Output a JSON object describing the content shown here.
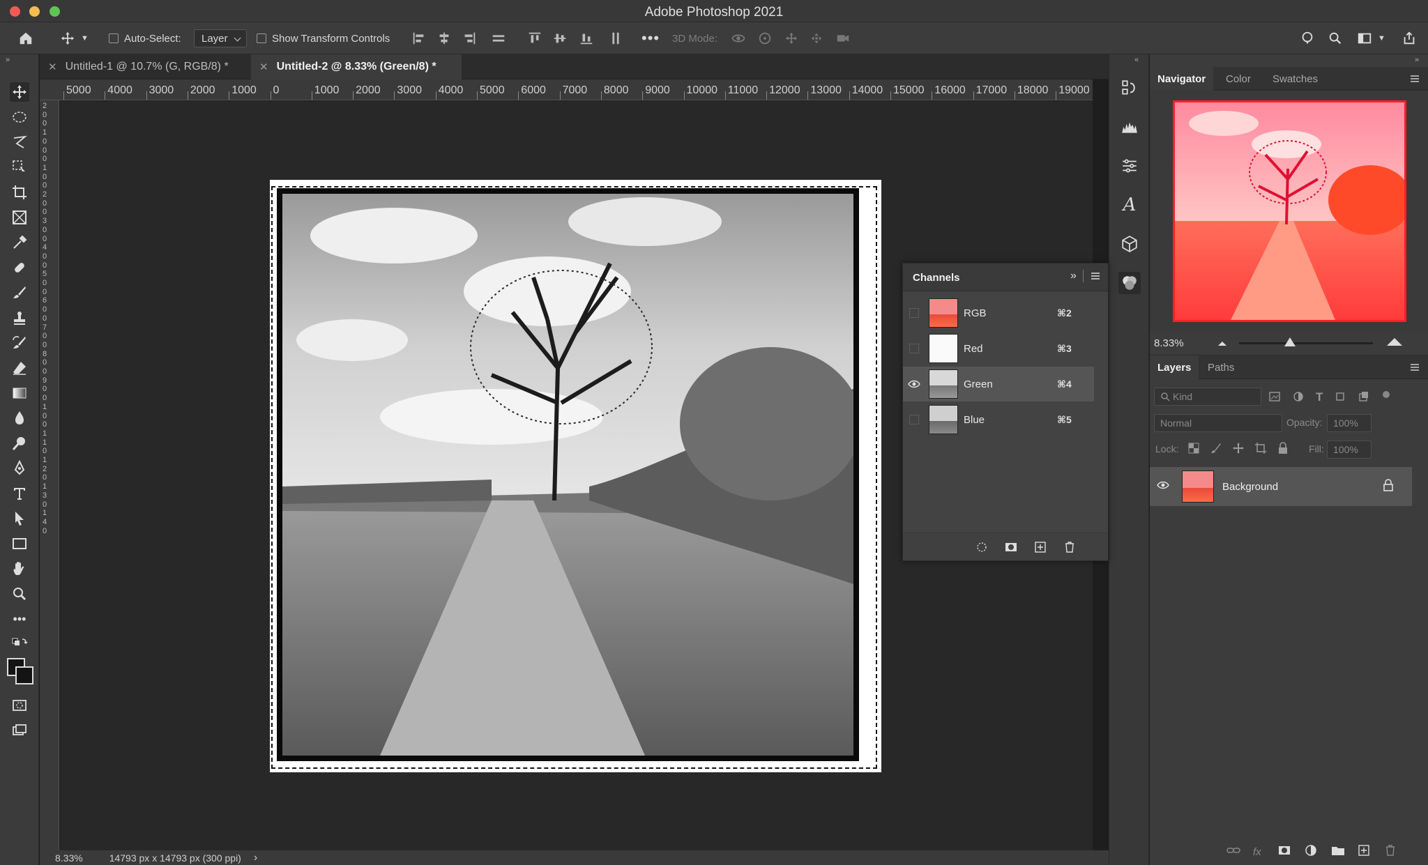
{
  "window": {
    "title": "Adobe Photoshop 2021"
  },
  "options_bar": {
    "auto_select_label": "Auto-Select:",
    "auto_select_value": "Layer",
    "show_transform_label": "Show Transform Controls",
    "mode_3d_label": "3D Mode:"
  },
  "tabs": [
    {
      "label": "Untitled-1 @ 10.7% (G, RGB/8) *",
      "active": false
    },
    {
      "label": "Untitled-2 @ 8.33% (Green/8) *",
      "active": true
    }
  ],
  "ruler": {
    "h_labels": [
      "5000",
      "4000",
      "3000",
      "2000",
      "1000",
      "0",
      "1000",
      "2000",
      "3000",
      "4000",
      "5000",
      "6000",
      "7000",
      "8000",
      "9000",
      "10000",
      "11000",
      "12000",
      "13000",
      "14000",
      "15000",
      "16000",
      "17000",
      "18000",
      "19000"
    ],
    "v_labels": [
      "2",
      "0",
      "0",
      "1",
      "0",
      "0",
      "0",
      "1",
      "0",
      "0",
      "2",
      "0",
      "0",
      "3",
      "0",
      "0",
      "4",
      "0",
      "0",
      "5",
      "0",
      "0",
      "6",
      "0",
      "0",
      "7",
      "0",
      "0",
      "8",
      "0",
      "0",
      "9",
      "0",
      "0",
      "1",
      "0",
      "0",
      "1",
      "1",
      "0",
      "1",
      "2",
      "0",
      "1",
      "3",
      "0",
      "1",
      "4",
      "0"
    ]
  },
  "status": {
    "zoom": "8.33%",
    "doc_info": "14793 px x 14793 px (300 ppi)",
    "arrow": "›"
  },
  "channels": {
    "title": "Channels",
    "rows": [
      {
        "name": "RGB",
        "shortcut": "⌘2",
        "visible": false,
        "selected": false
      },
      {
        "name": "Red",
        "shortcut": "⌘3",
        "visible": false,
        "selected": false
      },
      {
        "name": "Green",
        "shortcut": "⌘4",
        "visible": true,
        "selected": true
      },
      {
        "name": "Blue",
        "shortcut": "⌘5",
        "visible": false,
        "selected": false
      }
    ]
  },
  "navigator": {
    "tabs": [
      "Navigator",
      "Color",
      "Swatches"
    ],
    "zoom": "8.33%",
    "zoom_slider": 0.38
  },
  "layers": {
    "tabs": [
      "Layers",
      "Paths"
    ],
    "filter_kind": "Kind",
    "blend_mode": "Normal",
    "opacity_label": "Opacity:",
    "opacity_value": "100%",
    "lock_label": "Lock:",
    "fill_label": "Fill:",
    "fill_value": "100%",
    "items": [
      {
        "name": "Background",
        "locked": true
      }
    ]
  },
  "colors": {
    "accent_red": "#ff1e2c",
    "panel_bg": "#3c3c3c"
  }
}
